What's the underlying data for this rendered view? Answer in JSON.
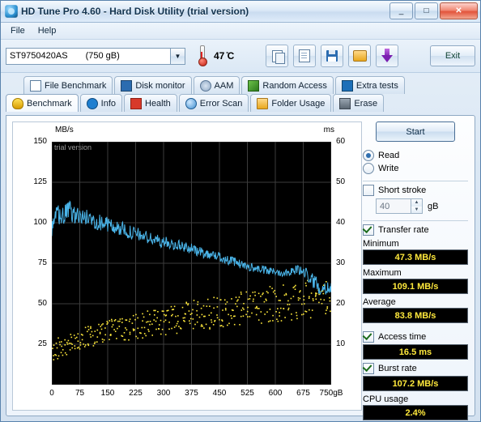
{
  "window": {
    "title": "HD Tune Pro 4.60 - Hard Disk Utility (trial version)",
    "icon": "disk-icon",
    "buttons": {
      "minimize": "_",
      "maximize": "□",
      "close": "✕"
    }
  },
  "menu": {
    "items": [
      "File",
      "Help"
    ]
  },
  "toolbar": {
    "drive": {
      "model": "ST9750420AS",
      "capacity": "(750 gB)",
      "arrow": "▼"
    },
    "temperature": "47 ̊C",
    "icons": [
      "copy-icon",
      "document-icon",
      "save-icon",
      "folder-icon",
      "download-icon"
    ],
    "exit_label": "Exit"
  },
  "tabs": {
    "row1": [
      {
        "label": "File Benchmark",
        "icon": "file-benchmark-icon",
        "active": false
      },
      {
        "label": "Disk monitor",
        "icon": "disk-monitor-icon",
        "active": false
      },
      {
        "label": "AAM",
        "icon": "aam-icon",
        "active": false
      },
      {
        "label": "Random Access",
        "icon": "random-access-icon",
        "active": false
      },
      {
        "label": "Extra tests",
        "icon": "extra-tests-icon",
        "active": false
      }
    ],
    "row2": [
      {
        "label": "Benchmark",
        "icon": "benchmark-icon",
        "active": true
      },
      {
        "label": "Info",
        "icon": "info-icon",
        "active": false
      },
      {
        "label": "Health",
        "icon": "health-icon",
        "active": false
      },
      {
        "label": "Error Scan",
        "icon": "error-scan-icon",
        "active": false
      },
      {
        "label": "Folder Usage",
        "icon": "folder-usage-icon",
        "active": false
      },
      {
        "label": "Erase",
        "icon": "erase-icon",
        "active": false
      }
    ]
  },
  "side": {
    "start_label": "Start",
    "mode": {
      "read_label": "Read",
      "write_label": "Write",
      "selected": "Read"
    },
    "short_stroke": {
      "label": "Short stroke",
      "checked": false,
      "value": "40",
      "unit": "gB"
    },
    "transfer_rate": {
      "label": "Transfer rate",
      "checked": true
    },
    "minimum": {
      "label": "Minimum",
      "value": "47.3 MB/s"
    },
    "maximum": {
      "label": "Maximum",
      "value": "109.1 MB/s"
    },
    "average": {
      "label": "Average",
      "value": "83.8 MB/s"
    },
    "access_time": {
      "label": "Access time",
      "checked": true,
      "value": "16.5 ms"
    },
    "burst_rate": {
      "label": "Burst rate",
      "checked": true,
      "value": "107.2 MB/s"
    },
    "cpu_usage": {
      "label": "CPU usage",
      "value": "2.4%"
    }
  },
  "chart_data": {
    "type": "line",
    "title": "",
    "watermark": "trial version",
    "ylabel_left": "MB/s",
    "ylabel_right": "ms",
    "xlabel": "750gB",
    "yticks_left": [
      0,
      25,
      50,
      75,
      100,
      125,
      150
    ],
    "yticks_right": [
      0,
      10,
      20,
      30,
      40,
      50,
      60
    ],
    "xticks": [
      "0",
      "75",
      "150",
      "225",
      "300",
      "375",
      "450",
      "525",
      "600",
      "675",
      "750gB"
    ],
    "ylim_left": [
      0,
      150
    ],
    "ylim_right": [
      0,
      60
    ],
    "xlim": [
      0,
      750
    ],
    "grid": true,
    "series": [
      {
        "name": "Transfer rate",
        "color": "#4ab4e8",
        "type": "line",
        "x": [
          0,
          15,
          30,
          45,
          60,
          75,
          95,
          115,
          135,
          150,
          170,
          190,
          210,
          225,
          245,
          265,
          285,
          300,
          320,
          340,
          360,
          375,
          395,
          415,
          435,
          450,
          470,
          490,
          510,
          525,
          545,
          565,
          585,
          600,
          620,
          640,
          660,
          675,
          695,
          710,
          725,
          740,
          750
        ],
        "y": [
          92,
          106,
          103,
          108,
          105,
          104,
          103,
          101,
          100,
          99,
          97,
          96,
          94,
          93,
          92,
          90,
          89,
          88,
          87,
          86,
          85,
          84,
          82,
          81,
          80,
          79,
          77,
          76,
          74,
          73,
          72,
          71,
          70,
          70,
          69,
          70,
          71,
          70,
          66,
          62,
          60,
          61,
          58
        ]
      },
      {
        "name": "Access time samples",
        "color": "#ffe93c",
        "type": "scatter",
        "x_range": [
          0,
          750
        ],
        "y_range_ms": [
          5,
          30
        ],
        "point_count": 420
      }
    ]
  }
}
